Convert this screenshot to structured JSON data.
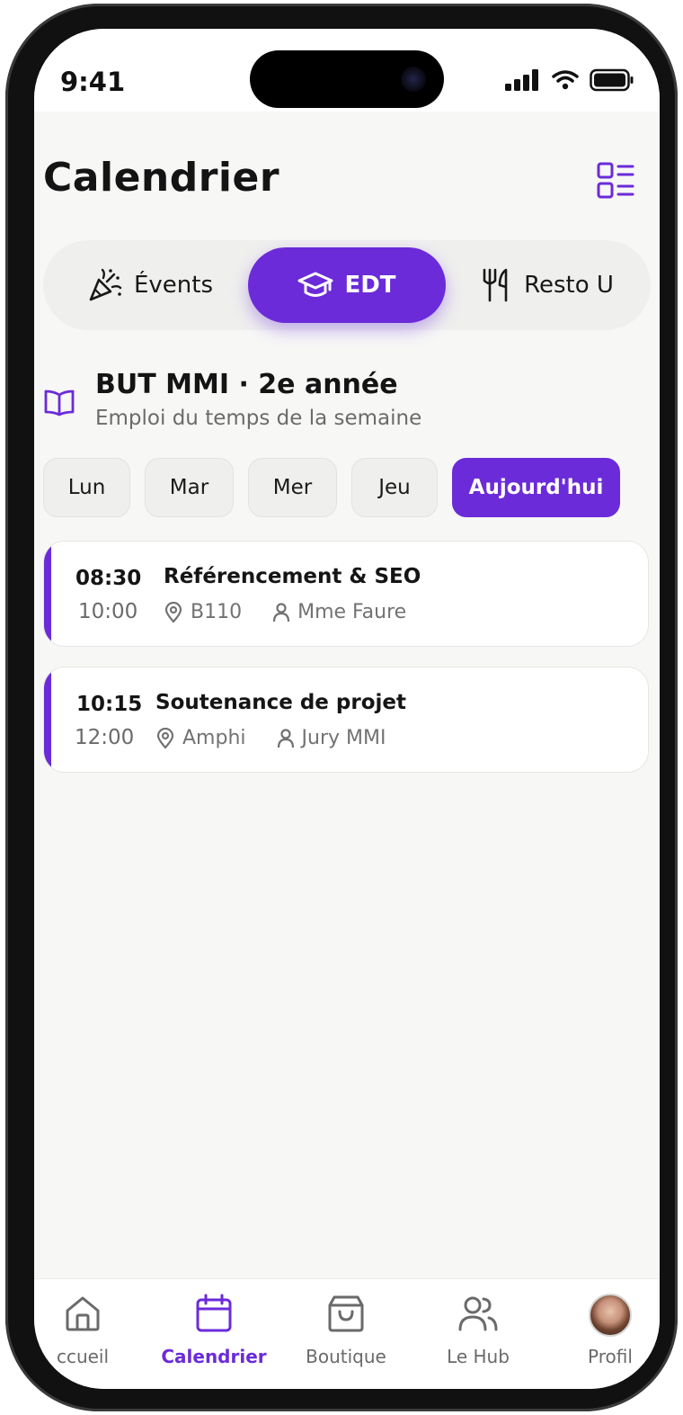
{
  "status_bar": {
    "time": "9:41"
  },
  "header": {
    "title": "Calendrier",
    "view_toggle_icon": "list-grid-icon"
  },
  "segments": [
    {
      "label": "Évents",
      "icon": "party-popper-icon",
      "active": false
    },
    {
      "label": "EDT",
      "icon": "graduation-cap-icon",
      "active": true
    },
    {
      "label": "Resto U",
      "icon": "fork-knife-icon",
      "active": false
    }
  ],
  "course": {
    "title": "BUT MMI · 2e année",
    "subtitle": "Emploi du temps de la semaine",
    "icon": "book-open-icon"
  },
  "days": [
    {
      "label": "Lun",
      "active": false
    },
    {
      "label": "Mar",
      "active": false
    },
    {
      "label": "Mer",
      "active": false
    },
    {
      "label": "Jeu",
      "active": false
    },
    {
      "label": "Aujourd'hui",
      "active": true
    }
  ],
  "events": [
    {
      "start": "08:30",
      "end": "10:00",
      "title": "Référencement & SEO",
      "room": "B110",
      "teacher": "Mme Faure"
    },
    {
      "start": "10:15",
      "end": "12:00",
      "title": "Soutenance de projet",
      "room": "Amphi",
      "teacher": "Jury MMI"
    }
  ],
  "tab_bar": [
    {
      "label": "ccueil",
      "icon": "home-icon",
      "active": false
    },
    {
      "label": "Calendrier",
      "icon": "calendar-icon",
      "active": true
    },
    {
      "label": "Boutique",
      "icon": "shopping-bag-icon",
      "active": false
    },
    {
      "label": "Le Hub",
      "icon": "users-icon",
      "active": false
    },
    {
      "label": "Profil",
      "icon": "avatar",
      "active": false
    }
  ],
  "colors": {
    "accent": "#6b2bd9",
    "background": "#f7f7f6",
    "text": "#141414",
    "muted": "#6b6b6b"
  }
}
